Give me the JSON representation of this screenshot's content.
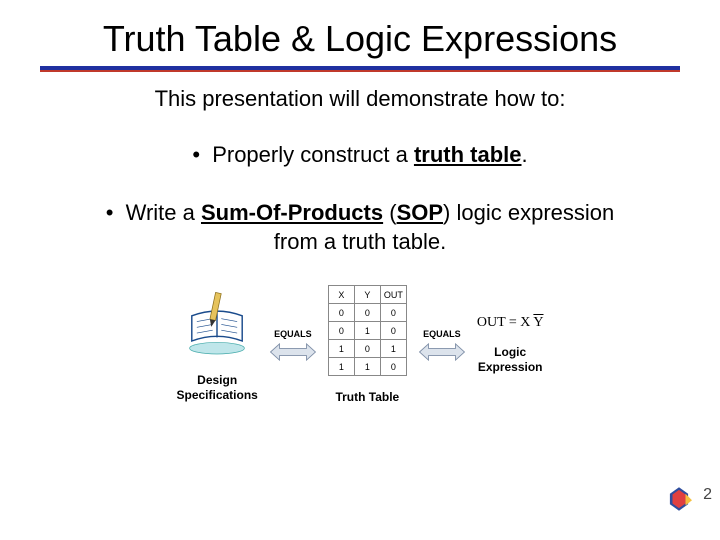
{
  "title": "Truth Table & Logic Expressions",
  "intro": "This presentation will demonstrate how to:",
  "bullet1": {
    "prefix": "Properly construct a ",
    "term": "truth table",
    "suffix": "."
  },
  "bullet2": {
    "prefix": "Write a ",
    "term": "Sum-Of-Products",
    "paren_open": " (",
    "abbr": "SOP",
    "paren_close": ") ",
    "suffix1": "logic expression from a truth table."
  },
  "arrows": {
    "left": "EQUALS",
    "right": "EQUALS"
  },
  "table": {
    "headers": [
      "X",
      "Y",
      "OUT"
    ],
    "rows": [
      [
        "0",
        "0",
        "0"
      ],
      [
        "0",
        "1",
        "0"
      ],
      [
        "1",
        "0",
        "1"
      ],
      [
        "1",
        "1",
        "0"
      ]
    ]
  },
  "captions": {
    "design": "Design\nSpecifications",
    "truth": "Truth Table",
    "logic": "Logic\nExpression"
  },
  "expr": {
    "lhs": "OUT",
    "eq": " = ",
    "x": "X ",
    "ybar": "Y"
  },
  "page_number": "2",
  "chart_data": {
    "type": "table",
    "title": "Truth Table",
    "headers": [
      "X",
      "Y",
      "OUT"
    ],
    "rows": [
      {
        "X": 0,
        "Y": 0,
        "OUT": 0
      },
      {
        "X": 0,
        "Y": 1,
        "OUT": 0
      },
      {
        "X": 1,
        "Y": 0,
        "OUT": 1
      },
      {
        "X": 1,
        "Y": 1,
        "OUT": 0
      }
    ]
  }
}
